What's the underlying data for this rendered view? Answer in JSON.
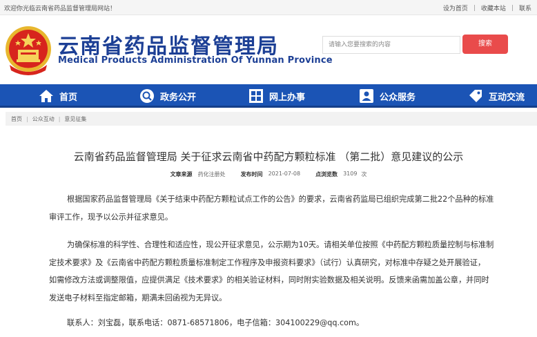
{
  "topbar": {
    "welcome": "欢迎你光临云南省药品监督管理局网站！",
    "set_home": "设为首页",
    "bookmark": "收藏本站",
    "contact": "联系"
  },
  "header": {
    "title_cn": "云南省药品监督管理局",
    "title_en": "Medical Products Administration Of Yunnan Province",
    "search_placeholder": "请输入您要搜索的内容",
    "search_button": "搜索"
  },
  "nav": {
    "home": "首页",
    "gov": "政务公开",
    "online": "网上办事",
    "service": "公众服务",
    "interact": "互动交流"
  },
  "breadcrumb": {
    "items": [
      "首页",
      "公众互动",
      "意见征集"
    ]
  },
  "article": {
    "title": "云南省药品监督管理局 关于征求云南省中药配方颗粒标准 （第二批）意见建议的公示",
    "meta": {
      "source_label": "文章来源",
      "source_value": "药化注册处",
      "time_label": "发布时间",
      "time_value": "2021-07-08",
      "views_label": "点浏览数",
      "views_value": "3109",
      "views_unit": "次"
    },
    "p1_lines": [
      "根据国家药品监督管理局《关于结束中药配方颗粒试点工作的公告》的要求，云南省药监局已组织完成第二批22个品种的标准",
      "审评工作，现予以公示并征求意见。"
    ],
    "p2_lines": [
      "为确保标准的科学性、合理性和适应性，现公开征求意见，公示期为10天。请相关单位按照《中药配方颗粒质量控制与标准制",
      "定技术要求》及《云南省中药配方颗粒质量标准制定工作程序及申报资料要求》（试行）认真研究，对标准中存疑之处开展验证，",
      "如需修改方法或调整限值，应提供满足《技术要求》的相关验证材料，同时附实验数据及相关说明。反馈来函需加盖公章，并同时",
      "发送电子材料至指定邮箱，期满未回函视为无异议。"
    ],
    "contact_line": "联系人：刘宝磊，联系电话：0871-68571806，电子信箱：304100229@qq.com。"
  }
}
